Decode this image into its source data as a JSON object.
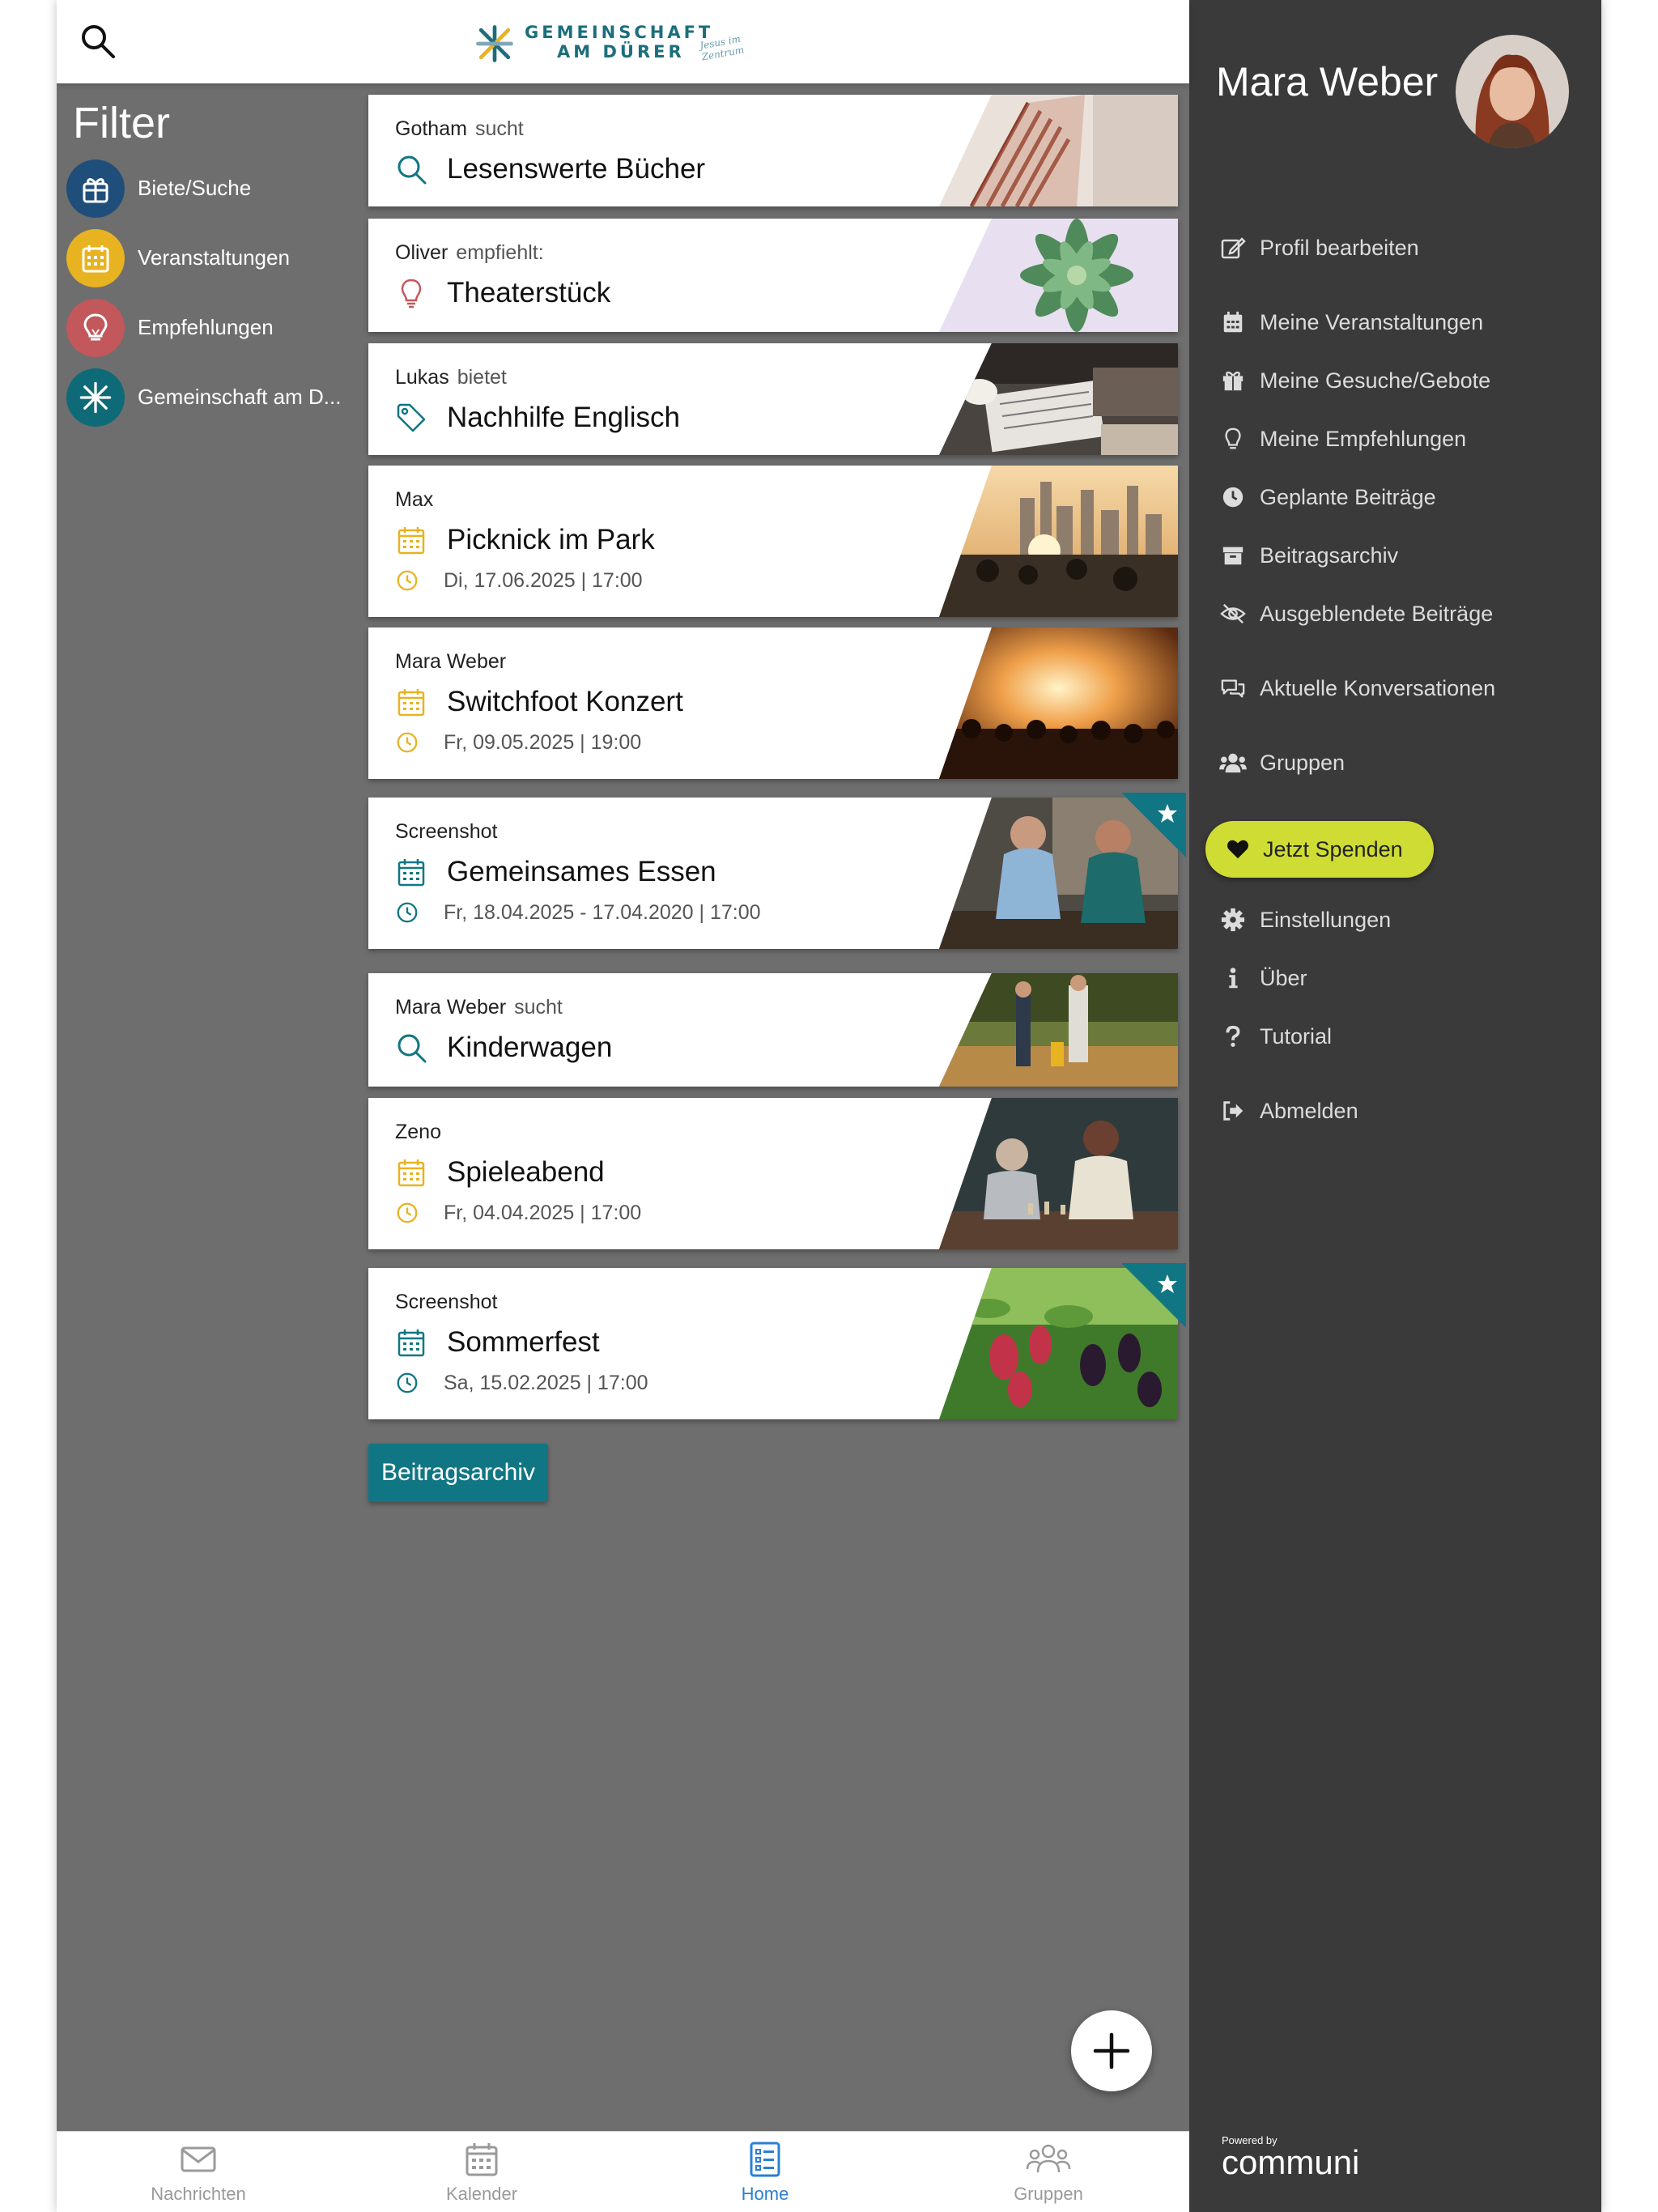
{
  "header": {
    "logo_line1": "GEMEINSCHAFT",
    "logo_line2": "AM DÜRER",
    "logo_script": "Jesus im Zentrum"
  },
  "filter": {
    "title": "Filter",
    "items": [
      {
        "label": "Biete/Suche",
        "color": "#1f4e7a",
        "icon": "gift-icon"
      },
      {
        "label": "Veranstaltungen",
        "color": "#e8b321",
        "icon": "calendar-icon"
      },
      {
        "label": "Empfehlungen",
        "color": "#c2575c",
        "icon": "lightbulb-icon"
      },
      {
        "label": "Gemeinschaft am D...",
        "color": "#0f6a77",
        "icon": "community-logo-icon"
      }
    ]
  },
  "posts": [
    {
      "author": "Gotham",
      "verb": "sucht",
      "title": "Lesenswerte Bücher",
      "type": "search",
      "date": "",
      "image": "books"
    },
    {
      "author": "Oliver",
      "verb": "empfiehlt:",
      "title": "Theaterstück",
      "type": "recommendation",
      "date": "",
      "image": "succulent"
    },
    {
      "author": "Lukas",
      "verb": "bietet",
      "title": "Nachhilfe Englisch",
      "type": "offer",
      "date": "",
      "image": "desk"
    },
    {
      "author": "Max",
      "verb": "",
      "title": "Picknick im Park",
      "type": "event",
      "date": "Di, 17.06.2025 | 17:00",
      "image": "city"
    },
    {
      "author": "Mara Weber",
      "verb": "",
      "title": "Switchfoot Konzert",
      "type": "event",
      "date": "Fr, 09.05.2025 | 19:00",
      "image": "concert"
    },
    {
      "author": "Screenshot",
      "verb": "",
      "title": "Gemeinsames Essen",
      "type": "event-community",
      "date": "Fr, 18.04.2025 - 17.04.2020 | 17:00",
      "image": "friends",
      "starred": true
    },
    {
      "author": "Mara Weber",
      "verb": "sucht",
      "title": "Kinderwagen",
      "type": "search",
      "date": "",
      "image": "park"
    },
    {
      "author": "Zeno",
      "verb": "",
      "title": "Spieleabend",
      "type": "event",
      "date": "Fr, 04.04.2025 | 17:00",
      "image": "chess"
    },
    {
      "author": "Screenshot",
      "verb": "",
      "title": "Sommerfest",
      "type": "event-community",
      "date": "Sa, 15.02.2025 | 17:00",
      "image": "berries",
      "starred": true
    }
  ],
  "archive_button": "Beitragsarchiv",
  "bottom_nav": [
    {
      "label": "Nachrichten",
      "icon": "envelope-icon"
    },
    {
      "label": "Kalender",
      "icon": "calendar-icon"
    },
    {
      "label": "Home",
      "icon": "list-icon",
      "active": true
    },
    {
      "label": "Gruppen",
      "icon": "group-icon"
    }
  ],
  "side_menu": {
    "user_name": "Mara Weber",
    "items": [
      {
        "label": "Profil bearbeiten",
        "icon": "edit-icon"
      },
      {
        "label": "Meine Veranstaltungen",
        "icon": "calendar-icon"
      },
      {
        "label": "Meine Gesuche/Gebote",
        "icon": "gift-icon"
      },
      {
        "label": "Meine Empfehlungen",
        "icon": "lightbulb-icon"
      },
      {
        "label": "Geplante Beiträge",
        "icon": "clock-icon"
      },
      {
        "label": "Beitragsarchiv",
        "icon": "archive-icon"
      },
      {
        "label": "Ausgeblendete Beiträge",
        "icon": "eye-slash-icon"
      },
      {
        "label": "Aktuelle Konversationen",
        "icon": "chat-icon"
      },
      {
        "label": "Gruppen",
        "icon": "users-icon"
      }
    ],
    "donate_label": "Jetzt Spenden",
    "items_bottom": [
      {
        "label": "Einstellungen",
        "icon": "gear-icon"
      },
      {
        "label": "Über",
        "icon": "info-icon"
      },
      {
        "label": "Tutorial",
        "icon": "question-icon"
      },
      {
        "label": "Abmelden",
        "icon": "logout-icon"
      }
    ],
    "powered_by": "Powered by",
    "powered_logo": "communi"
  },
  "colors": {
    "teal": "#107684",
    "yellow": "#e8b321",
    "red": "#c2575c",
    "navy": "#1f4e7a",
    "donate": "#cfdc34",
    "side_bg": "#3a3a3a",
    "overlay": "#6e6e6e"
  }
}
